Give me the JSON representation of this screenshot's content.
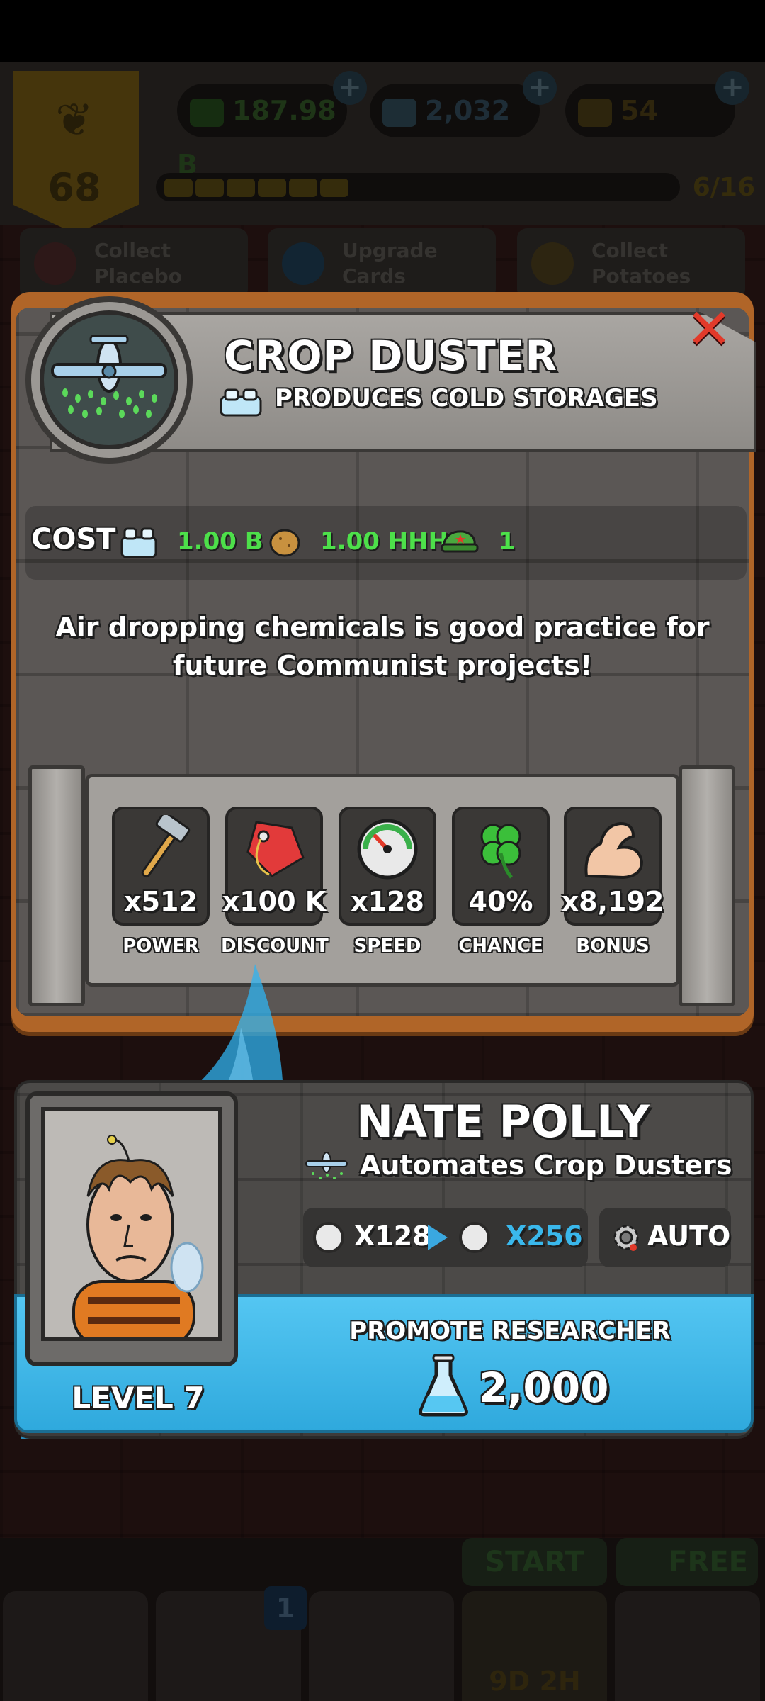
{
  "colors": {
    "accent_green": "#4de04a",
    "promote_blue": "#3ab4e8",
    "close_red": "#e23a2a",
    "upgrade_cyan": "#3ab8ec"
  },
  "background": {
    "player_level": "68",
    "resources": [
      {
        "icon": "cap-icon",
        "value": "187.98 B"
      },
      {
        "icon": "flask-icon",
        "value": "2,032"
      },
      {
        "icon": "potato-ticket-icon",
        "value": "54"
      }
    ],
    "xp_progress": "6/16",
    "xp_fraction": 0.375,
    "tasks": [
      {
        "label_line1": "Collect",
        "label_line2": "Placebo",
        "icon": "pill-icon"
      },
      {
        "label_line1": "Upgrade",
        "label_line2": "Cards",
        "icon": "arrow-up-icon"
      },
      {
        "label_line1": "Collect",
        "label_line2": "Potatoes",
        "icon": "potato-icon"
      }
    ],
    "bottom": {
      "start_label": "START",
      "free_label": "FREE",
      "cards_badge": "1",
      "timer": "9D 2H"
    }
  },
  "modal": {
    "title": "CROP DUSTER",
    "produces": "PRODUCES COLD STORAGES",
    "cost": {
      "label": "COST",
      "items": [
        {
          "icon": "cold-storage-icon",
          "value": "1.00 B"
        },
        {
          "icon": "potato-icon",
          "value": "1.00 HHH"
        },
        {
          "icon": "cap-icon",
          "value": "1"
        }
      ]
    },
    "description": "Air dropping chemicals is good practice for future Communist projects!",
    "stats": [
      {
        "icon": "hammer-icon",
        "value": "x512",
        "label": "POWER"
      },
      {
        "icon": "price-tag-icon",
        "value": "x100 K",
        "label": "DISCOUNT"
      },
      {
        "icon": "speedometer-icon",
        "value": "x128",
        "label": "SPEED"
      },
      {
        "icon": "clover-icon",
        "value": "40%",
        "label": "CHANCE"
      },
      {
        "icon": "bicep-icon",
        "value": "x8,192",
        "label": "BONUS"
      }
    ]
  },
  "researcher": {
    "name": "NATE POLLY",
    "automates": "Automates Crop Dusters",
    "current_mult": "X128",
    "next_mult": "X256",
    "auto_label": "AUTO",
    "level": "LEVEL 7",
    "promote_label": "PROMOTE RESEARCHER",
    "promote_cost": "2,000"
  }
}
